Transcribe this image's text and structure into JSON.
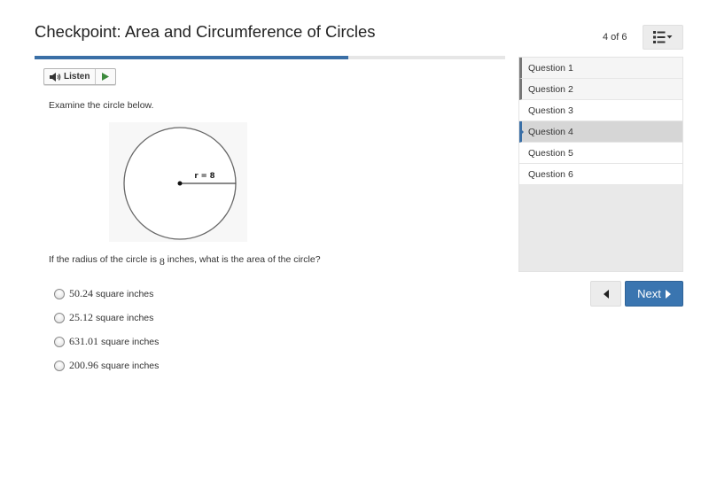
{
  "header": {
    "title": "Checkpoint: Area and Circumference of Circles",
    "counter": "4 of 6",
    "progress_percent": 66.7,
    "toc_icon": "list-menu-icon"
  },
  "listen": {
    "label": "Listen",
    "speaker_icon": "speaker-icon",
    "play_icon": "play-icon",
    "play_color": "#3c8a3c"
  },
  "content": {
    "prompt": "Examine the circle below.",
    "figure": {
      "radius_label": "r = 8"
    },
    "question_before": "If the radius of the circle is ",
    "question_value": "8",
    "question_after": " inches, what is the area of the circle?",
    "options": [
      {
        "value": "50.24",
        "unit": "square inches",
        "selected": false
      },
      {
        "value": "25.12",
        "unit": "square inches",
        "selected": false
      },
      {
        "value": "631.01",
        "unit": "square inches",
        "selected": false
      },
      {
        "value": "200.96",
        "unit": "square inches",
        "selected": false
      }
    ]
  },
  "sidebar": {
    "items": [
      {
        "label": "Question 1",
        "state": "answered"
      },
      {
        "label": "Question 2",
        "state": "answered"
      },
      {
        "label": "Question 3",
        "state": "unanswered"
      },
      {
        "label": "Question 4",
        "state": "current"
      },
      {
        "label": "Question 5",
        "state": "unanswered"
      },
      {
        "label": "Question 6",
        "state": "unanswered"
      }
    ]
  },
  "nav": {
    "prev_icon": "caret-left-icon",
    "next_label": "Next",
    "next_icon": "caret-right-icon",
    "accent_color": "#3a75b0"
  }
}
